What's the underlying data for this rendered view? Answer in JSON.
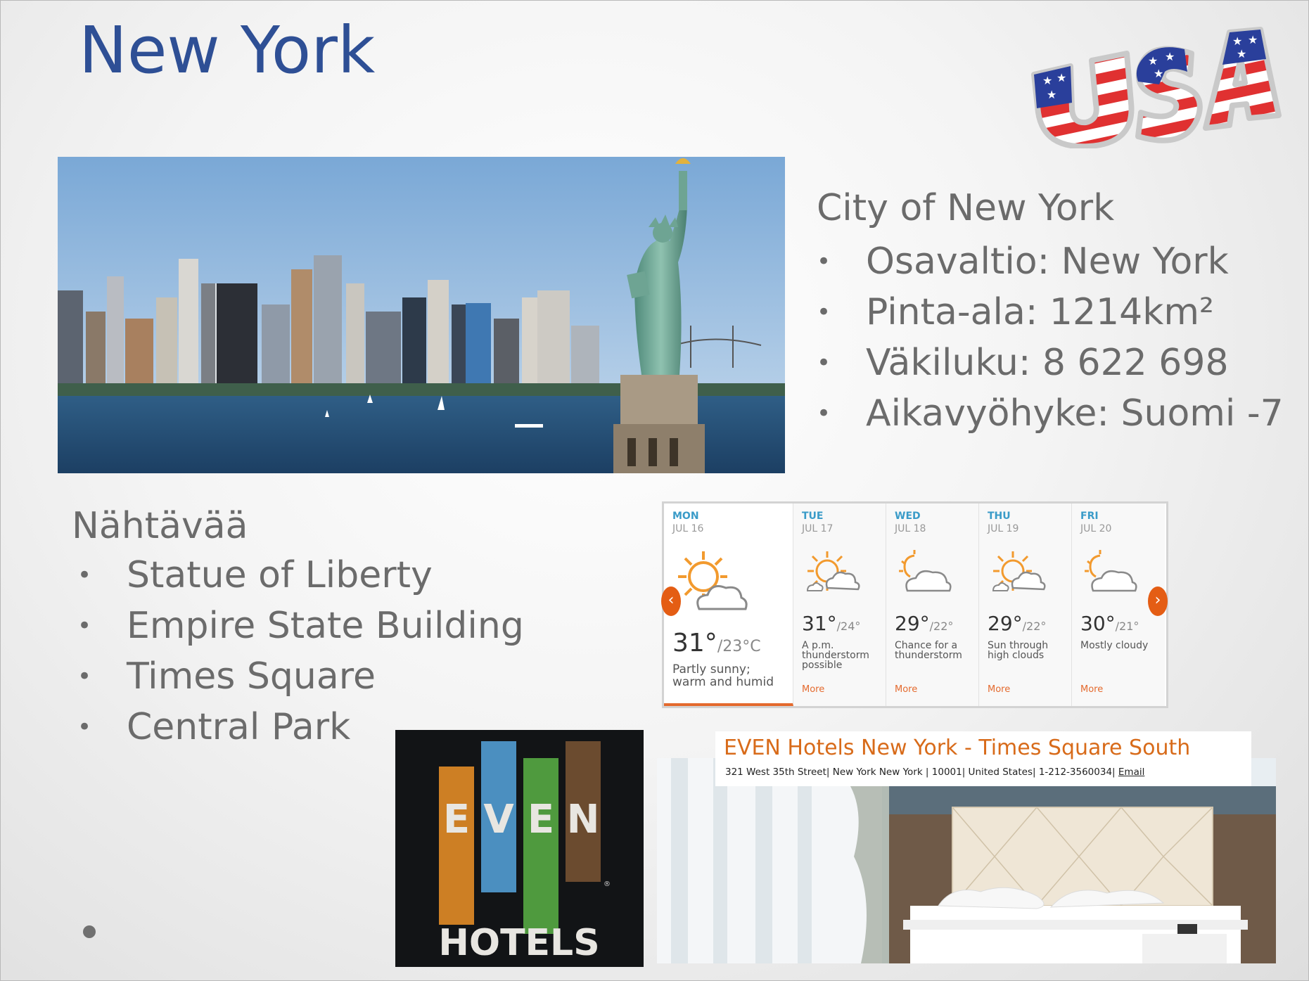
{
  "slide": {
    "title": "New York",
    "logo": "USA",
    "colors": {
      "title": "#2e4f95",
      "body_text": "#6b6b6b",
      "accent": "#e46a2e"
    }
  },
  "facts": {
    "heading": "City of New York",
    "items": [
      "Osavaltio: New York",
      "Pinta-ala: 1214km²",
      "Väkiluku: 8 622 698",
      "Aikavyöhyke: Suomi -7"
    ]
  },
  "sights": {
    "heading": "Nähtävää",
    "items": [
      "Statue of Liberty",
      "Empire State Building",
      "Times Square",
      "Central Park"
    ]
  },
  "weather": {
    "nav": {
      "prev_icon": "chevron-left-icon",
      "next_icon": "chevron-right-icon"
    },
    "days": [
      {
        "name": "MON",
        "date": "JUL 16",
        "high": "31°",
        "low": "/23°C",
        "desc": "Partly sunny; warm and humid",
        "icon": "sun-cloud-icon",
        "more": ""
      },
      {
        "name": "TUE",
        "date": "JUL 17",
        "high": "31°",
        "low": "/24°",
        "desc": "A p.m. thunderstorm possible",
        "icon": "sun-storm-icon",
        "more": "More"
      },
      {
        "name": "WED",
        "date": "JUL 18",
        "high": "29°",
        "low": "/22°",
        "desc": "Chance for a thunderstorm",
        "icon": "cloud-icon",
        "more": "More"
      },
      {
        "name": "THU",
        "date": "JUL 19",
        "high": "29°",
        "low": "/22°",
        "desc": "Sun through high clouds",
        "icon": "sun-storm-icon",
        "more": "More"
      },
      {
        "name": "FRI",
        "date": "JUL 20",
        "high": "30°",
        "low": "/21°",
        "desc": "Mostly cloudy",
        "icon": "cloud-icon",
        "more": "More"
      }
    ]
  },
  "even_logo": {
    "letters": [
      "E",
      "V",
      "E",
      "N"
    ],
    "sub": "HOTELS"
  },
  "hotel": {
    "name": "EVEN Hotels New York - Times Square South",
    "address": "321 West 35th Street| New York New York | 10001| United States| 1-212-3560034|",
    "email_label": "Email"
  }
}
